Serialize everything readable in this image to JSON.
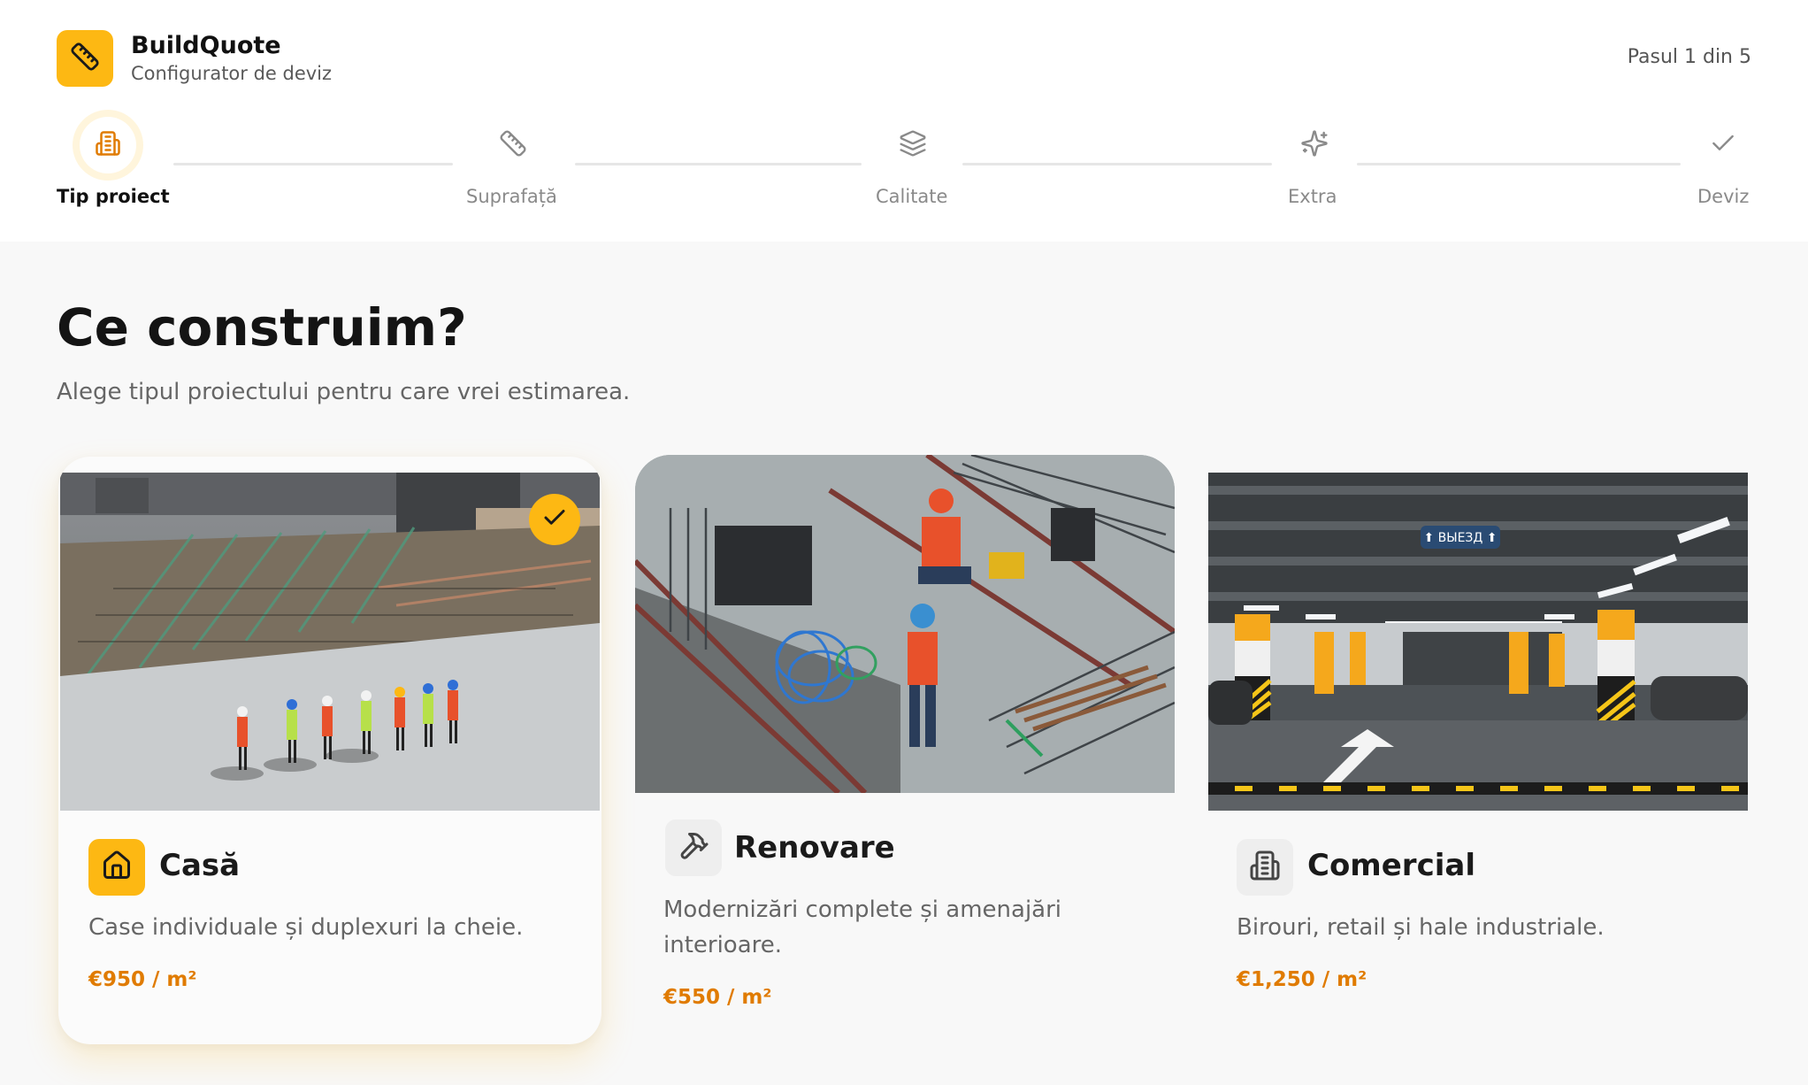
{
  "app": {
    "name": "BuildQuote",
    "subtitle": "Configurator de deviz",
    "step_counter": "Pasul 1 din 5",
    "accent_color": "#fdb813",
    "price_color": "#e07b00"
  },
  "steps": [
    {
      "label": "Tip proiect",
      "icon": "building-icon",
      "active": true
    },
    {
      "label": "Suprafață",
      "icon": "ruler-icon",
      "active": false
    },
    {
      "label": "Calitate",
      "icon": "layers-icon",
      "active": false
    },
    {
      "label": "Extra",
      "icon": "sparkles-icon",
      "active": false
    },
    {
      "label": "Deviz",
      "icon": "check-icon",
      "active": false
    }
  ],
  "main": {
    "title": "Ce construim?",
    "subtitle": "Alege tipul proiectului pentru care vrei estimarea."
  },
  "cards": [
    {
      "title": "Casă",
      "description": "Case individuale și duplexuri la cheie.",
      "price": "€950 / m²",
      "icon": "home-icon",
      "selected": true
    },
    {
      "title": "Renovare",
      "description_line1": "Modernizări complete și amenajări",
      "description_line2": "interioare.",
      "price": "€550 / m²",
      "icon": "hammer-icon",
      "selected": false
    },
    {
      "title": "Comercial",
      "description": "Birouri, retail și hale industriale.",
      "price": "€1,250 / m²",
      "icon": "building-icon",
      "selected": false
    }
  ],
  "images": {
    "parking_sign": "⬆ ВЫЕЗД ⬆"
  }
}
